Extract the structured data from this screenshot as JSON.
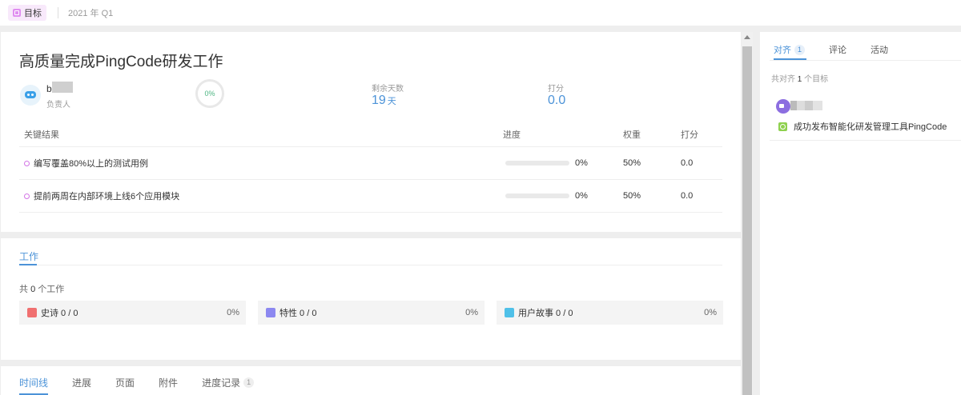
{
  "breadcrumb": {
    "tag": "目标",
    "period": "2021 年 Q1"
  },
  "objective": {
    "title": "高质量完成PingCode研发工作",
    "owner_initial": "b",
    "owner_role": "负责人",
    "progress_ring": "0%",
    "progress_value": 0,
    "remaining_label": "剩余天数",
    "remaining_value": "19",
    "remaining_unit": "天",
    "score_label": "打分",
    "score_value": "0.0"
  },
  "key_results": {
    "headers": {
      "name": "关键结果",
      "progress": "进度",
      "weight": "权重",
      "score": "打分"
    },
    "rows": [
      {
        "name": "编写覆盖80%以上的测试用例",
        "progress": "0%",
        "progress_value": 0,
        "weight": "50%",
        "score": "0.0"
      },
      {
        "name": "提前两周在内部环境上线6个应用模块",
        "progress": "0%",
        "progress_value": 0,
        "weight": "50%",
        "score": "0.0"
      }
    ]
  },
  "work": {
    "tab": "工作",
    "count_prefix": "共",
    "count": "0",
    "count_suffix": "个工作",
    "items": [
      {
        "label": "史诗 0 / 0",
        "pct": "0%",
        "icon": "epic-icon",
        "color": "#f07070"
      },
      {
        "label": "特性 0 / 0",
        "pct": "0%",
        "icon": "feature-icon",
        "color": "#8c88f0"
      },
      {
        "label": "用户故事 0 / 0",
        "pct": "0%",
        "icon": "story-icon",
        "color": "#4fc0e8"
      }
    ]
  },
  "bottom_tabs": [
    {
      "label": "时间线",
      "badge": ""
    },
    {
      "label": "进展",
      "badge": ""
    },
    {
      "label": "页面",
      "badge": ""
    },
    {
      "label": "附件",
      "badge": ""
    },
    {
      "label": "进度记录",
      "badge": "1"
    }
  ],
  "sidebar": {
    "tabs": [
      {
        "label": "对齐",
        "badge": "1"
      },
      {
        "label": "评论",
        "badge": ""
      },
      {
        "label": "活动",
        "badge": ""
      }
    ],
    "count_prefix": "共对齐",
    "count": "1",
    "count_suffix": "个目标",
    "aligned_goal": "成功发布智能化研发管理工具PingCode"
  },
  "colors": {
    "accent": "#4c93d8",
    "progress_green": "#4cb582",
    "kr_dot": "#d374e6"
  }
}
